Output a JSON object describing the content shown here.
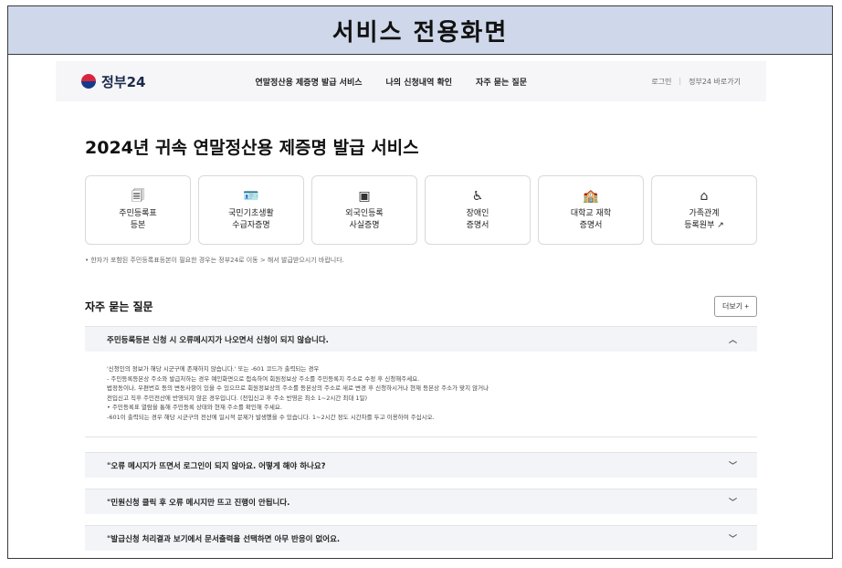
{
  "banner": {
    "title": "서비스 전용화면"
  },
  "header": {
    "logo_text": "정부24",
    "nav": [
      "연말정산용 제증명 발급 서비스",
      "나의 신청내역 확인",
      "자주 묻는 질문"
    ],
    "login": "로그인",
    "separator": "|",
    "goto": "정부24 바로가기"
  },
  "main": {
    "title": "2024년 귀속 연말정산용 제증명 발급 서비스",
    "cards": [
      {
        "icon": "document-icon",
        "glyph": "🗐",
        "label": "주민등록표\n등본"
      },
      {
        "icon": "id-card-icon",
        "glyph": "🪪",
        "label": "국민기초생활\n수급자증명"
      },
      {
        "icon": "alien-card-icon",
        "glyph": "▣",
        "label": "외국인등록\n사실증명"
      },
      {
        "icon": "wheelchair-icon",
        "glyph": "♿",
        "label": "장애인\n증명서"
      },
      {
        "icon": "school-icon",
        "glyph": "🏫",
        "label": "대학교 재학\n증명서"
      },
      {
        "icon": "family-house-icon",
        "glyph": "⌂",
        "label": "가족관계\n등록원부 ↗"
      }
    ],
    "note": "• 한자가 포함된 주민등록표등본이 필요한 경우는  정부24로 이동  >  해서 발급받으시기 바랍니다."
  },
  "faq": {
    "title": "자주 묻는 질문",
    "more_label": "더보기 +",
    "open_item": {
      "question": "주민등록등본 신청 시 오류메시지가 나오면서 신청이 되지 않습니다.",
      "answer": [
        "'신청인의 정보가 해당 시군구에 존재하지 않습니다.' 또는 -601 코드가 출력되는 경우",
        " - 주민등록등본상 주소와 발급처하는 경우 예인화면으로 접속하여 회원정보상 주소를 주민등록지 주소로 수정 후 신청해주세요.",
        "법정동이나, 우편번호 등의 변동사항이 있을 수 있으므로 회원정보상의 주소를 등본상의 주소로 새로 변경 후 신청하시거나 현재 등본상 주소가 맞지 않거나",
        "전입신고 직후 주민전산에 반영되지 않은 경우입니다. (전입신고 후 주소 반영은 최소 1~2시간 최대 1일)",
        "• 주민등록표 열람을 통해 주민등록 상태와 현재 주소를 확인해 주세요.",
        "-601이 출력되는 경우 해당 시군구의 전산에 일시적 문제가 발생했을 수 있습니다. 1~2시간 정도 시간차를 두고 이용하여 주십시오."
      ]
    },
    "closed_items": [
      "\"오류 메시지가 뜨면서 로그인이 되지 않아요. 어떻게 해야 하나요?",
      "\"민원신청 클릭 후 오류 메시지만 뜨고 진행이 안됩니다.",
      "\"발급신청 처리결과 보기에서 문서출력을 선택하면 아무 반응이 없어요."
    ]
  }
}
